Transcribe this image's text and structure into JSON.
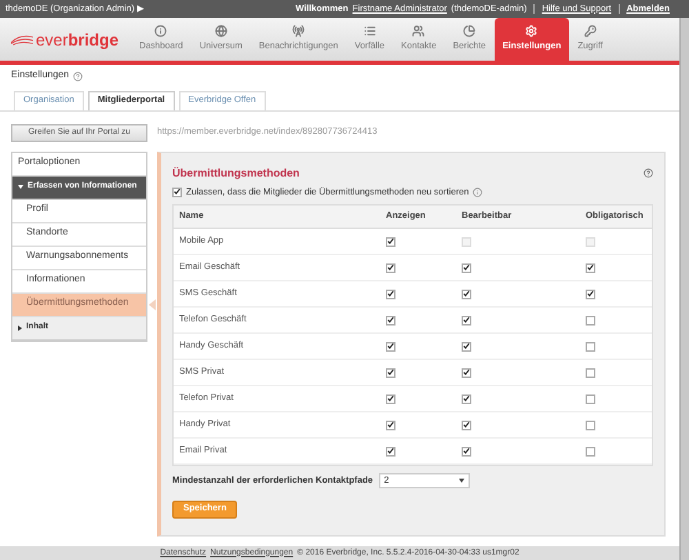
{
  "top_bar": {
    "org": "thdemoDE (Organization Admin)",
    "org_caret": "▶",
    "welcome": "Willkommen",
    "user_link": "Firstname Administrator",
    "user_id": "(thdemoDE-admin)",
    "help": "Hilfe und Support",
    "logout": "Abmelden"
  },
  "logo": {
    "light": "ever",
    "bold": "bridge"
  },
  "nav": [
    {
      "label": "Dashboard",
      "selected": false
    },
    {
      "label": "Universum",
      "selected": false
    },
    {
      "label": "Benachrichtigungen",
      "selected": false
    },
    {
      "label": "Vorfälle",
      "selected": false
    },
    {
      "label": "Kontakte",
      "selected": false
    },
    {
      "label": "Berichte",
      "selected": false
    },
    {
      "label": "Einstellungen",
      "selected": true
    },
    {
      "label": "Zugriff",
      "selected": false
    }
  ],
  "breadcrumb": "Einstellungen",
  "tabs": [
    {
      "label": "Organisation",
      "selected": false
    },
    {
      "label": "Mitgliederportal",
      "selected": true
    },
    {
      "label": "Everbridge Offen",
      "selected": false
    }
  ],
  "portal_button": "Greifen Sie auf Ihr Portal zu",
  "portal_url": "https://member.everbridge.net/index/892807736724413",
  "sidebar": [
    {
      "label": "Portaloptionen",
      "kind": "item",
      "selected": false
    },
    {
      "label": "Erfassen von Informationen",
      "kind": "section",
      "expanded": true,
      "children": [
        {
          "label": "Profil",
          "kind": "item",
          "selected": false
        },
        {
          "label": "Standorte",
          "kind": "item",
          "selected": false
        },
        {
          "label": "Warnungsabonnements",
          "kind": "item",
          "selected": false
        },
        {
          "label": "Informationen",
          "kind": "item",
          "selected": false
        },
        {
          "label": "Übermittlungsmethoden",
          "kind": "item",
          "selected": true
        }
      ]
    },
    {
      "label": "Inhalt",
      "kind": "section",
      "expanded": false
    }
  ],
  "panel": {
    "title": "Übermittlungsmethoden",
    "reorder": {
      "label": "Zulassen, dass die Mitglieder die Übermittlungsmethoden neu sortieren",
      "checked": true
    },
    "columns": [
      "Name",
      "Anzeigen",
      "Bearbeitbar",
      "Obligatorisch"
    ],
    "rows": [
      {
        "name": "Mobile App",
        "show": {
          "checked": true,
          "disabled": false
        },
        "edit": {
          "checked": false,
          "disabled": true
        },
        "required": {
          "checked": false,
          "disabled": true
        }
      },
      {
        "name": "Email Geschäft",
        "show": {
          "checked": true,
          "disabled": false
        },
        "edit": {
          "checked": true,
          "disabled": false
        },
        "required": {
          "checked": true,
          "disabled": false
        }
      },
      {
        "name": "SMS Geschäft",
        "show": {
          "checked": true,
          "disabled": false
        },
        "edit": {
          "checked": true,
          "disabled": false
        },
        "required": {
          "checked": true,
          "disabled": false
        }
      },
      {
        "name": "Telefon Geschäft",
        "show": {
          "checked": true,
          "disabled": false
        },
        "edit": {
          "checked": true,
          "disabled": false
        },
        "required": {
          "checked": false,
          "disabled": false
        }
      },
      {
        "name": "Handy Geschäft",
        "show": {
          "checked": true,
          "disabled": false
        },
        "edit": {
          "checked": true,
          "disabled": false
        },
        "required": {
          "checked": false,
          "disabled": false
        }
      },
      {
        "name": "SMS Privat",
        "show": {
          "checked": true,
          "disabled": false
        },
        "edit": {
          "checked": true,
          "disabled": false
        },
        "required": {
          "checked": false,
          "disabled": false
        }
      },
      {
        "name": "Telefon Privat",
        "show": {
          "checked": true,
          "disabled": false
        },
        "edit": {
          "checked": true,
          "disabled": false
        },
        "required": {
          "checked": false,
          "disabled": false
        }
      },
      {
        "name": "Handy Privat",
        "show": {
          "checked": true,
          "disabled": false
        },
        "edit": {
          "checked": true,
          "disabled": false
        },
        "required": {
          "checked": false,
          "disabled": false
        }
      },
      {
        "name": "Email Privat",
        "show": {
          "checked": true,
          "disabled": false
        },
        "edit": {
          "checked": true,
          "disabled": false
        },
        "required": {
          "checked": false,
          "disabled": false
        }
      }
    ],
    "min_label": "Mindestanzahl der erforderlichen Kontaktpfade",
    "min_value": "2",
    "save": "Speichern"
  },
  "footer": {
    "privacy": "Datenschutz",
    "terms": "Nutzungsbedingungen",
    "copyright": "© 2016 Everbridge, Inc. 5.5.2.4-2016-04-30-04:33 us1mgr02"
  }
}
